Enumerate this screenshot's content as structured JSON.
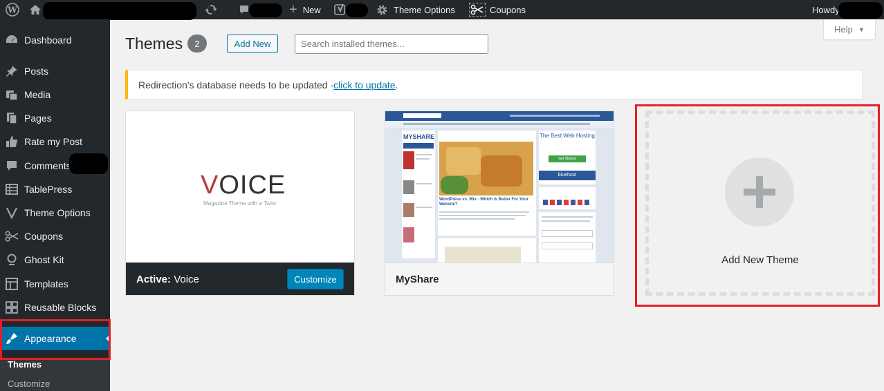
{
  "admin_bar": {
    "new_label": "New",
    "theme_options_label": "Theme Options",
    "coupons_label": "Coupons",
    "howdy_label": "Howdy"
  },
  "sidebar": {
    "items": [
      {
        "label": "Dashboard",
        "icon": "dashboard-icon"
      },
      {
        "label": "Posts",
        "icon": "pin-icon"
      },
      {
        "label": "Media",
        "icon": "media-icon"
      },
      {
        "label": "Pages",
        "icon": "pages-icon"
      },
      {
        "label": "Rate my Post",
        "icon": "thumbs-up-icon"
      },
      {
        "label": "Comments",
        "icon": "comment-icon"
      },
      {
        "label": "TablePress",
        "icon": "table-icon"
      },
      {
        "label": "Theme Options",
        "icon": "v-logo-icon"
      },
      {
        "label": "Coupons",
        "icon": "scissors-icon"
      },
      {
        "label": "Ghost Kit",
        "icon": "ghost-icon"
      },
      {
        "label": "Templates",
        "icon": "templates-icon"
      },
      {
        "label": "Reusable Blocks",
        "icon": "blocks-icon"
      },
      {
        "label": "Appearance",
        "icon": "brush-icon"
      }
    ],
    "submenu": [
      {
        "label": "Themes"
      },
      {
        "label": "Customize"
      }
    ]
  },
  "main": {
    "title": "Themes",
    "count": "2",
    "add_new_label": "Add New",
    "search_placeholder": "Search installed themes...",
    "help_label": "Help"
  },
  "notice": {
    "text": "Redirection's database needs to be updated - ",
    "link_text": "click to update",
    "suffix": "."
  },
  "themes": [
    {
      "status_prefix": "Active:",
      "name": "Voice",
      "customize_label": "Customize",
      "logo_text": "OICE",
      "logo_first_letter": "V",
      "tagline": "Magazine Theme with a Twist"
    },
    {
      "name": "MyShare",
      "logo_text": "MYSHARE",
      "headline": "WordPress vs. Wix - Which is Better For Your Website?",
      "ad_text": "The Best Web Hosting",
      "ad_button": "Get Started",
      "ad_brand": "bluehost"
    }
  ],
  "add_new_theme_label": "Add New Theme",
  "colors": {
    "admin_dark": "#23282d",
    "accent_blue": "#0073aa",
    "highlight_red": "#e41f26",
    "notice_yellow": "#ffb900"
  }
}
